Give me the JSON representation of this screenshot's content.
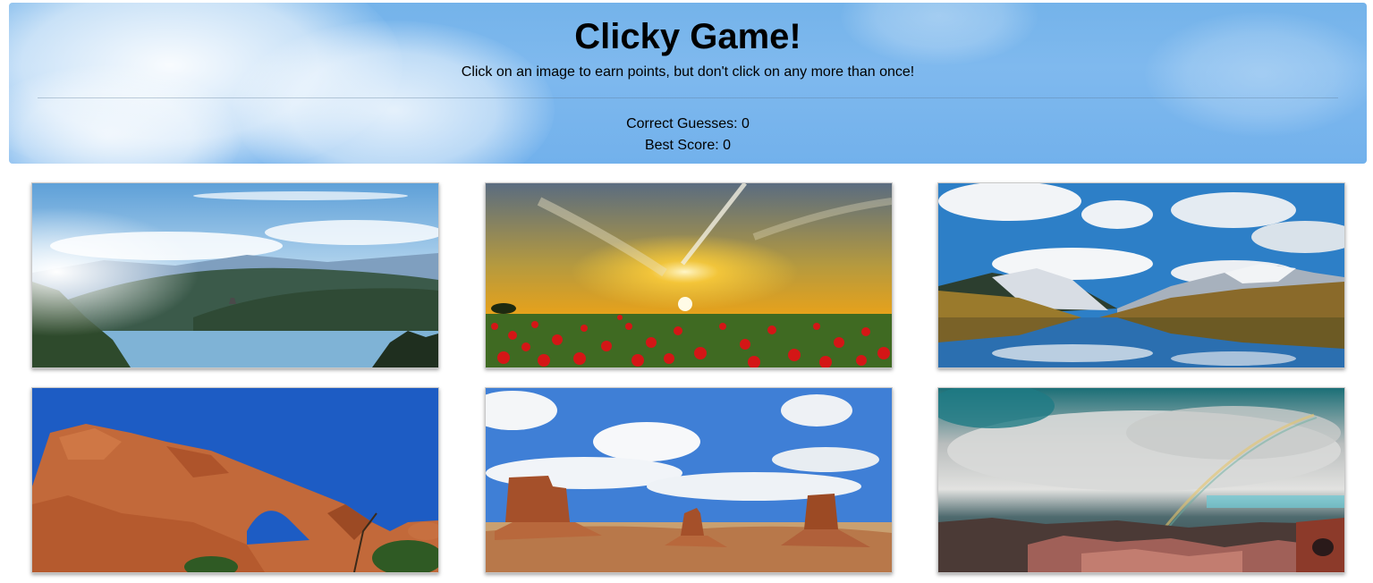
{
  "header": {
    "title": "Clicky Game!",
    "subtitle": "Click on an image to earn points, but don't click on any more than once!",
    "correct_label": "Correct Guesses: 0",
    "best_label": "Best Score: 0"
  },
  "cards": [
    {
      "scene": "lake-valley-castle"
    },
    {
      "scene": "poppy-field-sunset"
    },
    {
      "scene": "mountain-lake-reflection"
    },
    {
      "scene": "red-rock-arch"
    },
    {
      "scene": "monument-valley-buttes"
    },
    {
      "scene": "canyon-rainbow-storm"
    }
  ]
}
